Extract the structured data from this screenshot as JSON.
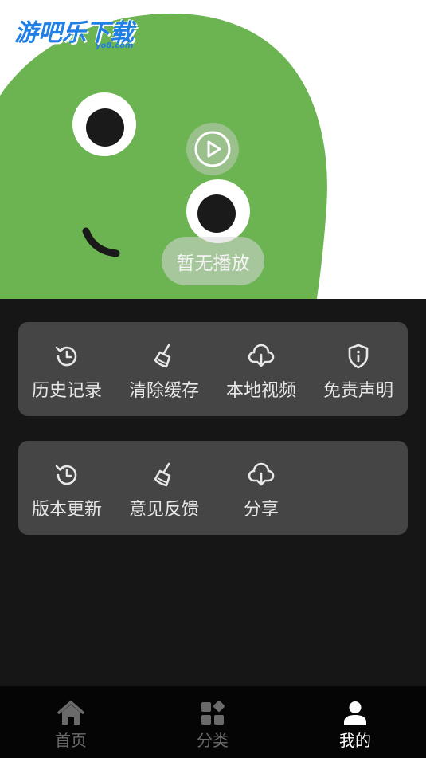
{
  "watermark": {
    "brand": "游吧乐下载",
    "domain": "yo8.com"
  },
  "player": {
    "status_text": "暂无播放"
  },
  "menu_card_1": [
    {
      "label": "历史记录",
      "icon": "history-icon"
    },
    {
      "label": "清除缓存",
      "icon": "broom-icon"
    },
    {
      "label": "本地视频",
      "icon": "cloud-download-icon"
    },
    {
      "label": "免责声明",
      "icon": "shield-info-icon"
    }
  ],
  "menu_card_2": [
    {
      "label": "版本更新",
      "icon": "history-icon"
    },
    {
      "label": "意见反馈",
      "icon": "broom-icon"
    },
    {
      "label": "分享",
      "icon": "cloud-download-icon"
    }
  ],
  "tabs": [
    {
      "label": "首页",
      "icon": "home-icon",
      "active": false
    },
    {
      "label": "分类",
      "icon": "category-icon",
      "active": false
    },
    {
      "label": "我的",
      "icon": "user-icon",
      "active": true
    }
  ],
  "colors": {
    "background": "#161616",
    "card": "#454545",
    "mascot_green": "#6cb352",
    "tab_active": "#ffffff",
    "tab_inactive": "#6a6a6a"
  }
}
